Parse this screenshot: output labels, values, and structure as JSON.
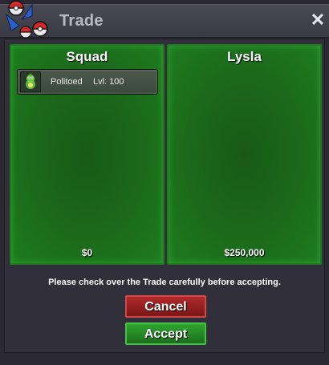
{
  "window": {
    "title": "Trade",
    "close_symbol": "✕"
  },
  "icons": {
    "logo": "pokeball-swirl-icon",
    "close": "close-icon",
    "sprite": "politoed-sprite-icon"
  },
  "left_panel": {
    "name": "Squad",
    "money": "$0",
    "items": [
      {
        "pokemon": "Politoed",
        "level": "Lvl: 100"
      }
    ]
  },
  "right_panel": {
    "name": "Lysla",
    "money": "$250,000",
    "items": []
  },
  "notice": "Please check over the Trade carefully before accepting.",
  "buttons": {
    "cancel": "Cancel",
    "accept": "Accept"
  },
  "colors": {
    "panel_green": "#1b6a1b",
    "cancel_red": "#9a2020",
    "accept_green": "#239523"
  }
}
